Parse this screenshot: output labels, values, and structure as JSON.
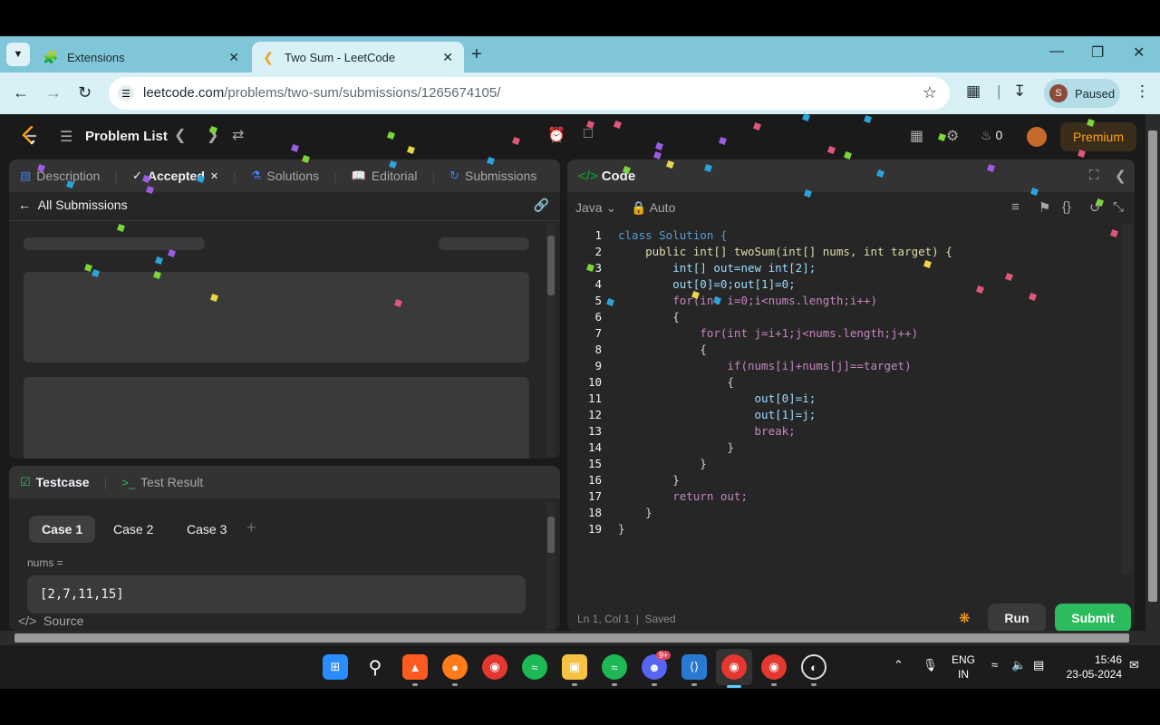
{
  "browser": {
    "tabs": [
      {
        "label": "Extensions",
        "icon": "puzzle-icon",
        "active": false
      },
      {
        "label": "Two Sum - LeetCode",
        "icon": "leetcode-icon",
        "active": true
      }
    ],
    "url_host": "leetcode.com",
    "url_path": "/problems/two-sum/submissions/1265674105/",
    "profile_initial": "S",
    "profile_label": "Paused"
  },
  "nav": {
    "problem_list": "Problem List",
    "streak_count": "0",
    "premium": "Premium"
  },
  "left_tabs": [
    {
      "label": "Description",
      "icon": "document-icon",
      "active": false
    },
    {
      "label": "Accepted",
      "icon": "check-icon",
      "active": true
    },
    {
      "label": "Solutions",
      "icon": "flask-icon",
      "active": false
    },
    {
      "label": "Editorial",
      "icon": "book-icon",
      "active": false
    },
    {
      "label": "Submissions",
      "icon": "history-icon",
      "active": false
    }
  ],
  "submissions": {
    "back_label": "All Submissions"
  },
  "testcase": {
    "tab_testcase": "Testcase",
    "tab_result": "Test Result",
    "cases": [
      "Case 1",
      "Case 2",
      "Case 3"
    ],
    "nums_label": "nums =",
    "nums_value": "[2,7,11,15]",
    "source_label": "Source"
  },
  "code": {
    "title": "Code",
    "language": "Java",
    "mode": "Auto",
    "lines": [
      "class Solution {",
      "    public int[] twoSum(int[] nums, int target) {",
      "        int[] out=new int[2];",
      "        out[0]=0;out[1]=0;",
      "        for(int i=0;i<nums.length;i++)",
      "        {",
      "            for(int j=i+1;j<nums.length;j++)",
      "            {",
      "                if(nums[i]+nums[j]==target)",
      "                {",
      "                    out[0]=i;",
      "                    out[1]=j;",
      "                    break;",
      "                }",
      "            }",
      "        }",
      "        return out;",
      "    }",
      "}"
    ],
    "status_pos": "Ln 1, Col 1",
    "status_saved": "Saved",
    "run": "Run",
    "submit": "Submit"
  },
  "taskbar": {
    "lang_top": "ENG",
    "lang_bottom": "IN",
    "time": "15:46",
    "date": "23-05-2024",
    "discord_badge": "9+"
  }
}
